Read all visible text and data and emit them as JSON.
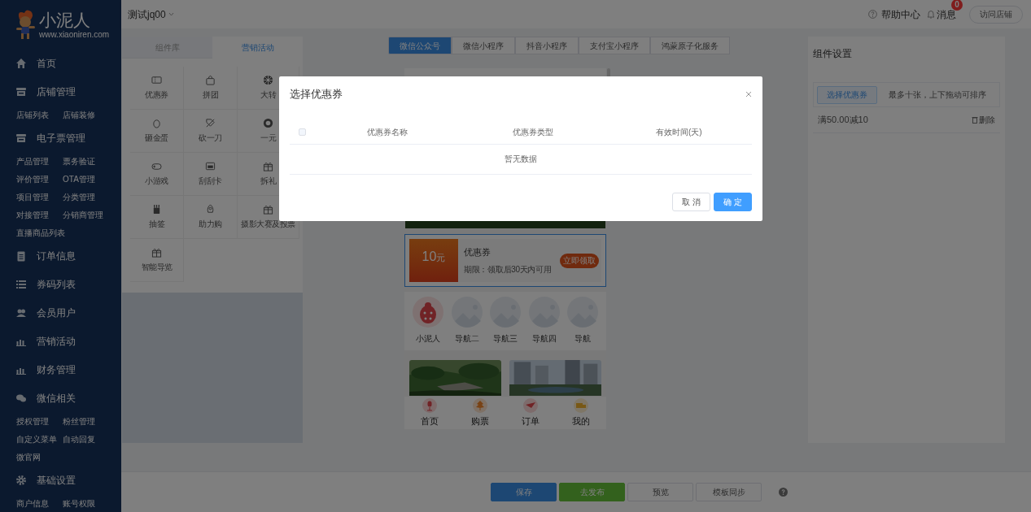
{
  "sidebar": {
    "logo": {
      "name": "小泥人",
      "url": "www.xiaoniren.com"
    },
    "menu": [
      {
        "label": "首页"
      },
      {
        "label": "店铺管理",
        "children": [
          {
            "label": "店铺列表"
          },
          {
            "label": "店铺装修"
          }
        ]
      },
      {
        "label": "电子票管理",
        "children": [
          {
            "label": "产品管理"
          },
          {
            "label": "票务验证"
          },
          {
            "label": "评价管理"
          },
          {
            "label": "OTA管理"
          },
          {
            "label": "项目管理"
          },
          {
            "label": "分类管理"
          },
          {
            "label": "对接管理"
          },
          {
            "label": "分销商管理"
          },
          {
            "label": "直播商品列表"
          }
        ]
      },
      {
        "label": "订单信息"
      },
      {
        "label": "券码列表"
      },
      {
        "label": "会员用户"
      },
      {
        "label": "营销活动"
      },
      {
        "label": "财务管理"
      },
      {
        "label": "微信相关",
        "children": [
          {
            "label": "授权管理"
          },
          {
            "label": "粉丝管理"
          },
          {
            "label": "自定义菜单"
          },
          {
            "label": "自动回复"
          },
          {
            "label": "微官网"
          }
        ]
      },
      {
        "label": "基础设置",
        "children": [
          {
            "label": "商户信息"
          },
          {
            "label": "账号权限"
          }
        ]
      }
    ]
  },
  "top_bar": {
    "store": "测试jq00",
    "help": "帮助中心",
    "messages": {
      "label": "消息",
      "badge": "0"
    },
    "visit_button": "访问店铺"
  },
  "component_panel": {
    "tabs": [
      {
        "label": "组件库",
        "selected": false
      },
      {
        "label": "营销活动",
        "selected": true
      }
    ],
    "items": [
      "优惠券",
      "拼团",
      "大转",
      "砸金蛋",
      "砍一刀",
      "一元",
      "小游戏",
      "刮刮卡",
      "拆礼",
      "抽签",
      "助力购",
      "摄影大赛及投票",
      "智能导览"
    ]
  },
  "platform_tabs": [
    {
      "label": "微信公众号",
      "selected": true
    },
    {
      "label": "微信小程序",
      "selected": false
    },
    {
      "label": "抖音小程序",
      "selected": false
    },
    {
      "label": "支付宝小程序",
      "selected": false
    },
    {
      "label": "鸿蒙原子化服务",
      "selected": false
    }
  ],
  "phone": {
    "blocks": [
      {
        "kind": "banner",
        "selected": false
      },
      {
        "kind": "coupon",
        "selected": true,
        "amount": "10",
        "unit": "元",
        "title": "优惠券",
        "term": "期限：领取后30天内可用",
        "button": "立即领取"
      },
      {
        "kind": "nav",
        "selected": false,
        "items": [
          {
            "label": "小泥人",
            "kind": "icon"
          },
          {
            "label": "导航二",
            "kind": "placeholder"
          },
          {
            "label": "导航三",
            "kind": "placeholder"
          },
          {
            "label": "导航四",
            "kind": "placeholder"
          },
          {
            "label": "导航",
            "kind": "placeholder"
          }
        ]
      },
      {
        "kind": "gallery",
        "selected": false
      }
    ],
    "tab_bar": [
      "首页",
      "购票",
      "订单",
      "我的"
    ]
  },
  "settings_panel": {
    "title": "组件设置",
    "select_button": "选择优惠券",
    "hint": "最多十张，上下拖动可排序",
    "coupons": [
      {
        "name": "满50.00减10",
        "action": "删除"
      }
    ]
  },
  "bottom_bar": {
    "buttons": [
      {
        "label": "保存",
        "kind": "primary"
      },
      {
        "label": "去发布",
        "kind": "success"
      },
      {
        "label": "预览",
        "kind": "default"
      },
      {
        "label": "模板同步",
        "kind": "default"
      }
    ]
  },
  "modal": {
    "title": "选择优惠券",
    "select_all": {
      "checked": false
    },
    "columns": [
      "优惠券名称",
      "优惠券类型",
      "有效时间(天)"
    ],
    "empty_text": "暂无数据",
    "buttons": [
      {
        "label": "取 消",
        "kind": "default"
      },
      {
        "label": "确 定",
        "kind": "primary"
      }
    ]
  }
}
